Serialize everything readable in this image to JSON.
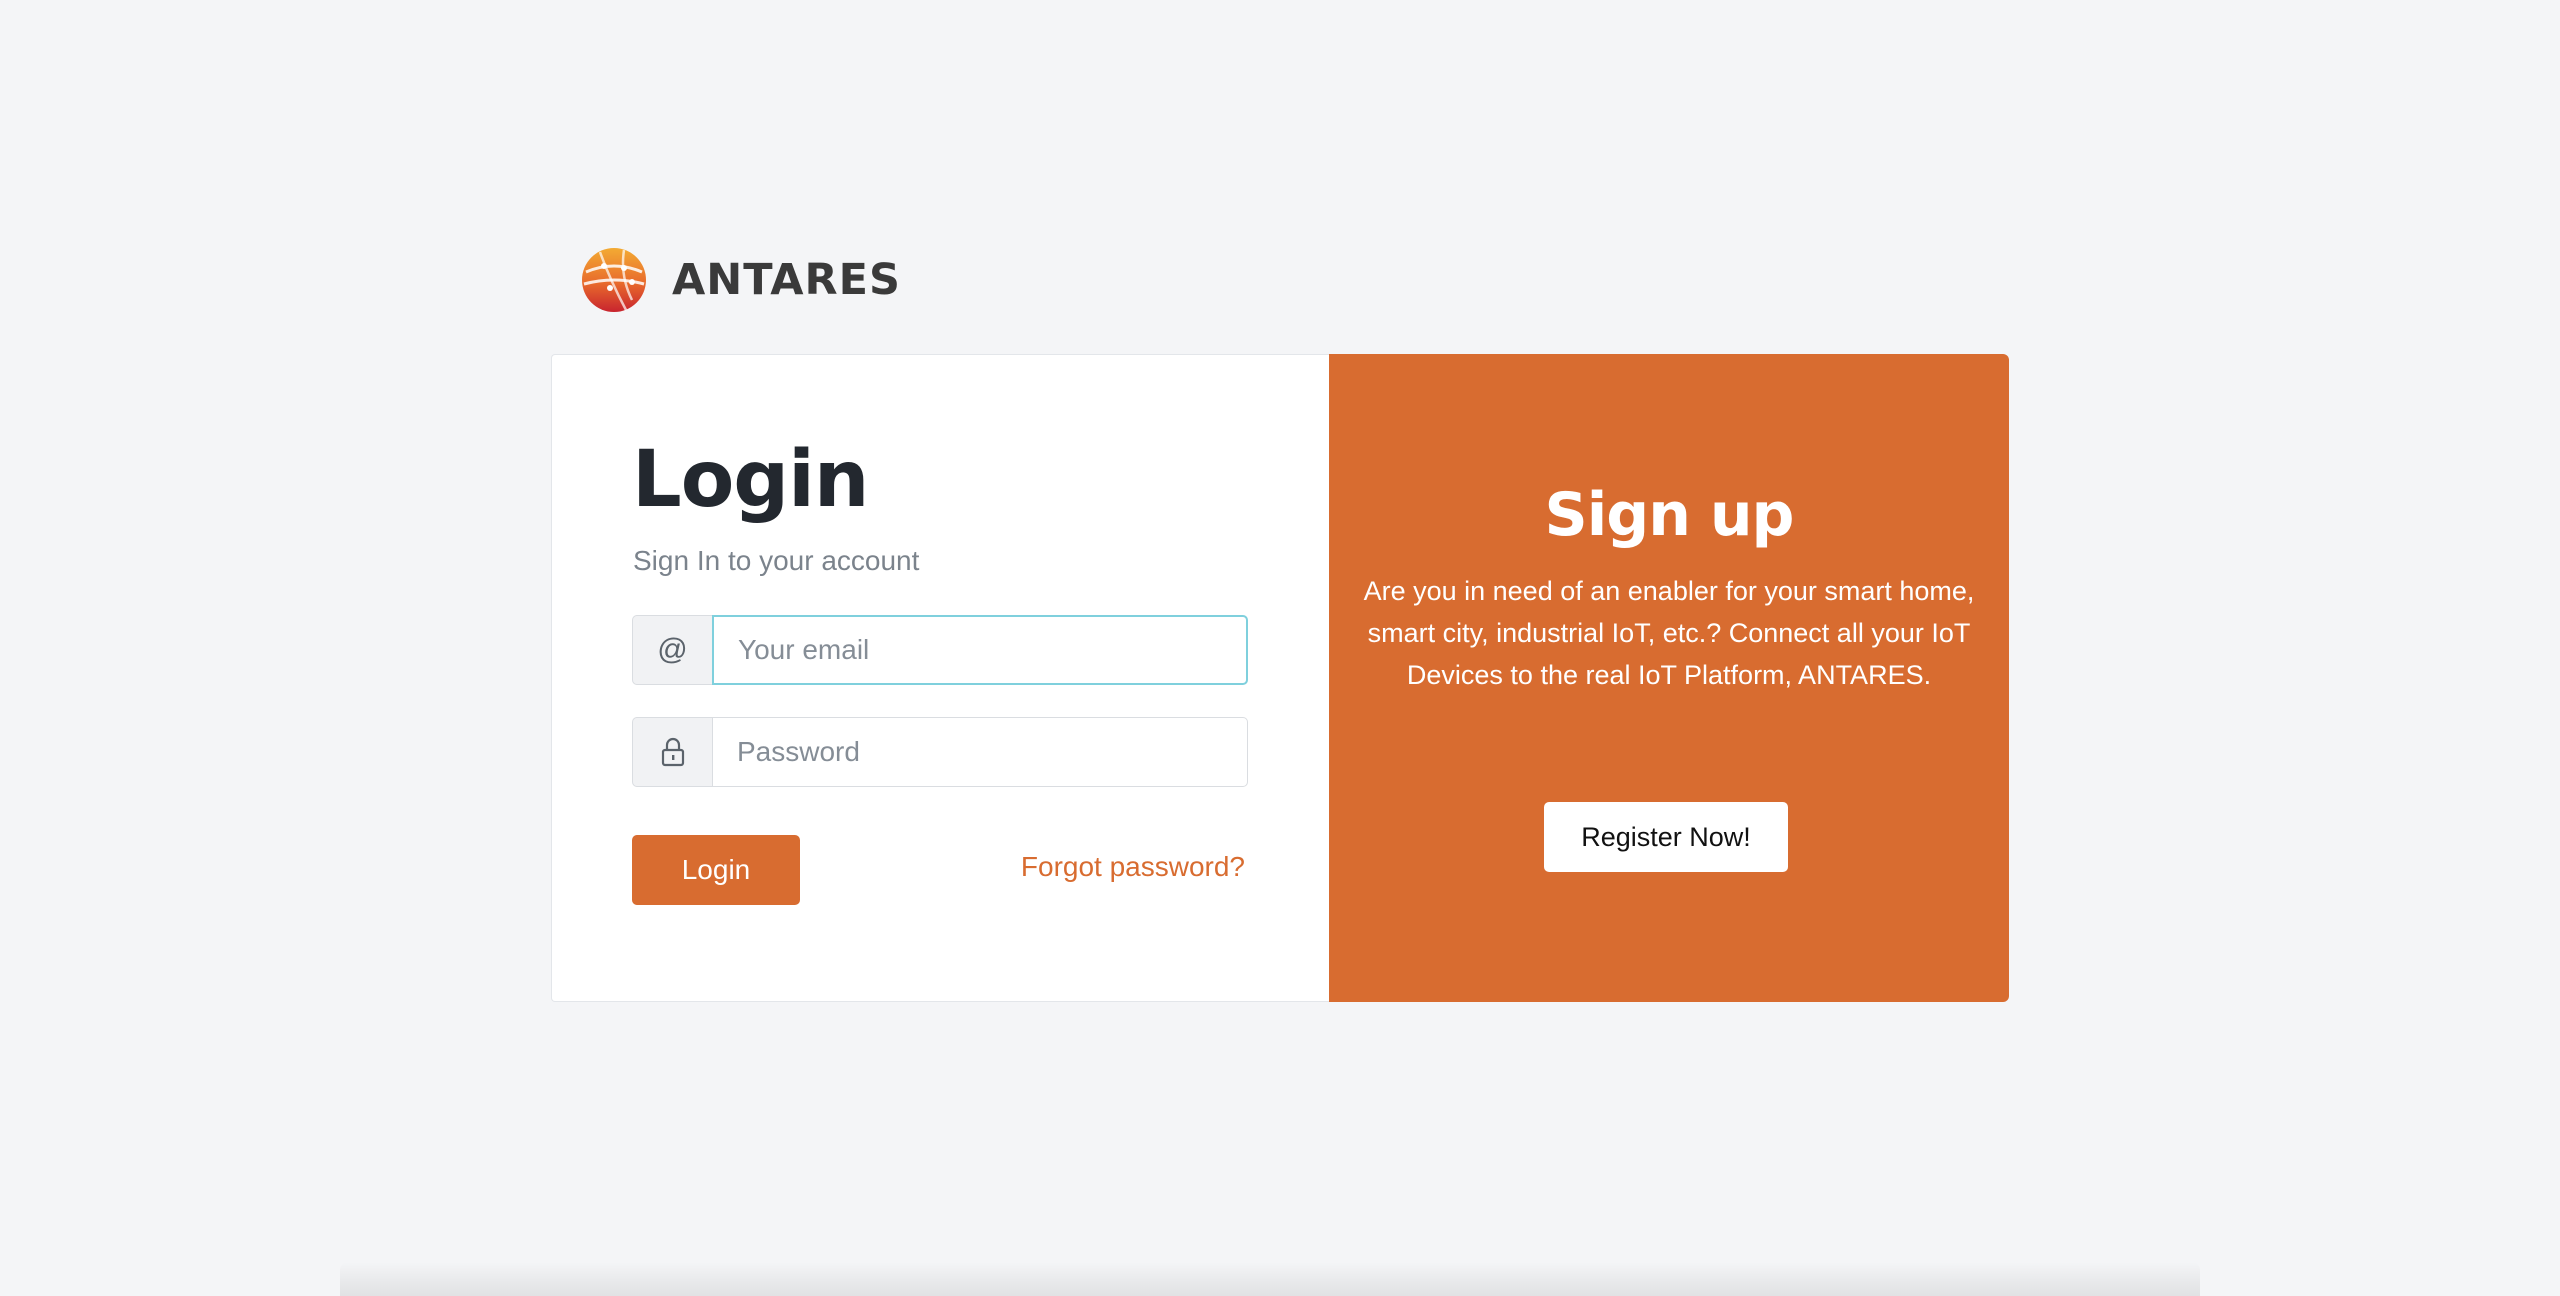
{
  "brand": {
    "name": "ANTARES",
    "logo_icon": "globe-logo-icon",
    "colors": {
      "orange": "#f0a030",
      "red": "#c8242e"
    }
  },
  "login": {
    "title": "Login",
    "subtitle": "Sign In to your account",
    "email": {
      "prefix": "@",
      "placeholder": "Your email",
      "value": ""
    },
    "password": {
      "prefix_icon": "lock-icon",
      "placeholder": "Password",
      "value": ""
    },
    "login_button": "Login",
    "forgot_link": "Forgot password?"
  },
  "signup": {
    "title": "Sign up",
    "description": "Are you in need of an enabler for your smart home, smart city, industrial IoT, etc.? Connect all your IoT Devices to the real IoT Platform, ANTARES.",
    "register_button": "Register Now!"
  },
  "theme": {
    "accent": "#d86c30",
    "background": "#f4f5f7",
    "focus_border": "#7fd0dd"
  }
}
